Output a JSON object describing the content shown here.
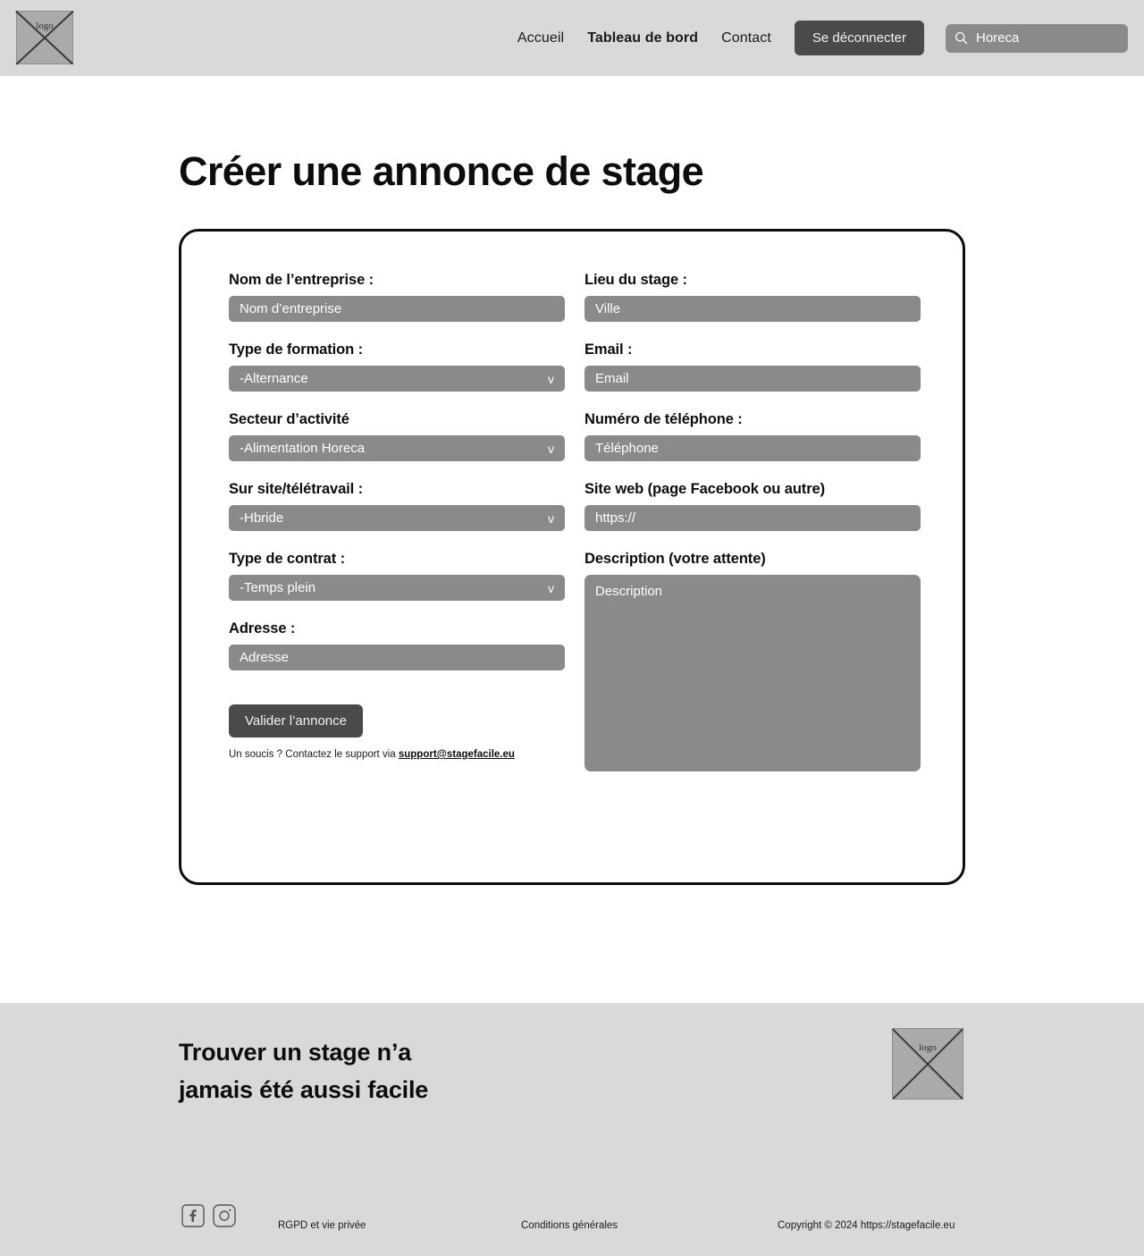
{
  "header": {
    "logo_alt": "logo",
    "nav": [
      {
        "label": "Accueil",
        "active": false
      },
      {
        "label": "Tableau de bord",
        "active": true
      },
      {
        "label": "Contact",
        "active": false
      }
    ],
    "logout_label": "Se déconnecter",
    "search": {
      "icon": "search-icon",
      "value": "Horeca"
    }
  },
  "main": {
    "page_title": "Créer une annonce de stage",
    "form": {
      "left": {
        "company_name": {
          "label": "Nom de l’entreprise :",
          "placeholder": "Nom d’entreprise"
        },
        "training_type": {
          "label": "Type de formation :",
          "value": "-Alternance",
          "chevron": "v"
        },
        "sector": {
          "label": "Secteur d’activité",
          "value": "-Alimentation Horeca",
          "chevron": "v"
        },
        "worksite": {
          "label": "Sur site/télétravail :",
          "value": "-Hbride",
          "chevron": "v"
        },
        "contract_type": {
          "label": "Type de contrat :",
          "value": "-Temps plein",
          "chevron": "v"
        },
        "address": {
          "label": "Adresse :",
          "placeholder": "Adresse"
        }
      },
      "right": {
        "location": {
          "label": "Lieu du stage :",
          "placeholder": "Ville"
        },
        "email": {
          "label": "Email :",
          "placeholder": "Email"
        },
        "phone": {
          "label": "Numéro de téléphone :",
          "placeholder": "Téléphone"
        },
        "website": {
          "label": "Site web (page Facebook ou autre)",
          "placeholder": "https://"
        },
        "description": {
          "label": "Description (votre attente)",
          "placeholder": "Description"
        }
      },
      "submit_label": "Valider l’annonce",
      "support_prefix": "Un soucis ? Contactez le support via ",
      "support_email": "support@stagefacile.eu"
    }
  },
  "footer": {
    "tagline_line1": "Trouver un stage n’a",
    "tagline_line2": "jamais été aussi facile",
    "logo_alt": "logo",
    "socials": [
      {
        "name": "facebook-icon"
      },
      {
        "name": "instagram-icon"
      }
    ],
    "links": {
      "privacy": "RGPD et vie privée",
      "terms": "Conditions générales",
      "copyright": "Copyright © 2024 https://stagefacile.eu"
    }
  },
  "colors": {
    "header_bg": "#d9d9d9",
    "footer_bg": "#d9d9d9",
    "field_bg": "#8a8a8a",
    "button_bg": "#4a4a4a",
    "text": "#0d0d0d",
    "placeholder": "#ffffff"
  }
}
